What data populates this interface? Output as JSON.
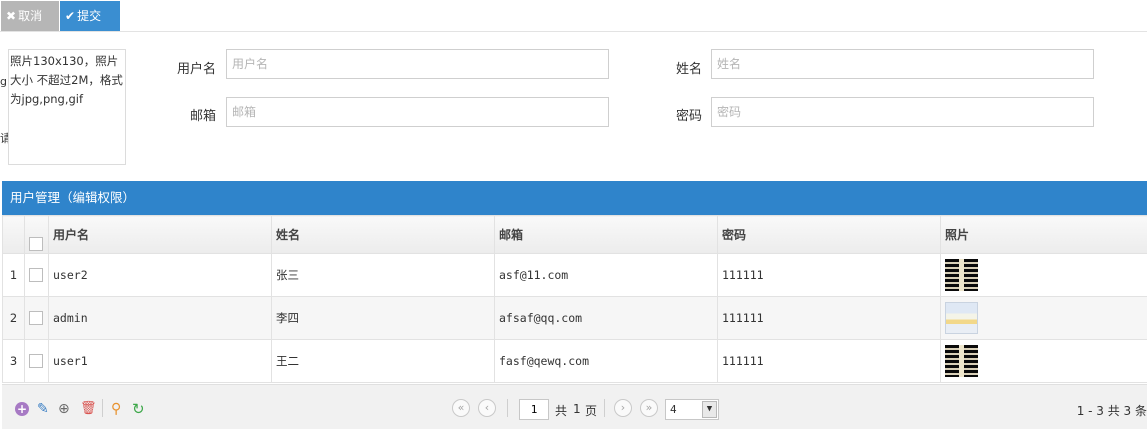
{
  "toolbar": {
    "cancel_label": "取消",
    "submit_label": "提交"
  },
  "form": {
    "photo_hint": "照片130x130，照片大小 不超过2M，格式为jpg,png,gif",
    "edge_left_1": "g",
    "edge_left_2": "请",
    "username_label": "用户名",
    "username_placeholder": "用户名",
    "name_label": "姓名",
    "name_placeholder": "姓名",
    "email_label": "邮箱",
    "email_placeholder": "邮箱",
    "password_label": "密码",
    "password_placeholder": "密码"
  },
  "grid": {
    "title": "用户管理（编辑权限）",
    "columns": [
      "用户名",
      "姓名",
      "邮箱",
      "密码",
      "照片"
    ],
    "rows": [
      {
        "num": "1",
        "username": "user2",
        "name": "张三",
        "email": "asf@11.com",
        "password": "111111",
        "photo_icon": "xray-thumbnail"
      },
      {
        "num": "2",
        "username": "admin",
        "name": "李四",
        "email": "afsaf@qq.com",
        "password": "111111",
        "photo_icon": "screenshot-thumbnail"
      },
      {
        "num": "3",
        "username": "user1",
        "name": "王二",
        "email": "fasf@qewq.com",
        "password": "111111",
        "photo_icon": "xray-thumbnail"
      }
    ]
  },
  "pager": {
    "page_input": "1",
    "total_pages_prefix": "共",
    "total_pages": "1",
    "total_pages_suffix": "页",
    "page_size": "4",
    "info": "1 - 3  共 3 条"
  },
  "icons": {
    "cancel": "close-icon",
    "submit": "check-icon",
    "add": "add-icon",
    "edit": "pencil-icon",
    "view": "zoom-icon",
    "delete": "trash-icon",
    "search": "search-icon",
    "refresh": "refresh-icon"
  },
  "colors": {
    "accent": "#2f84cb",
    "submit": "#3a8ed1",
    "cancel": "#b6b6b6",
    "link": "#2b71b5"
  }
}
